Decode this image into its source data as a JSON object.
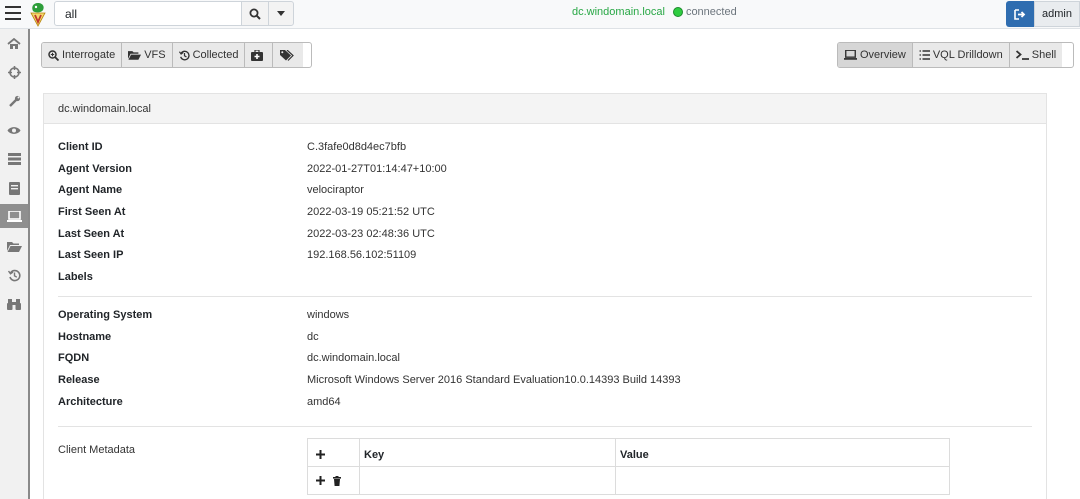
{
  "app": {
    "search": {
      "value": "all"
    },
    "connection": {
      "host": "dc.windomain.local",
      "status": "connected"
    },
    "user": {
      "name": "admin"
    }
  },
  "sidebar": {
    "items": [
      {
        "icon": "home-icon"
      },
      {
        "icon": "crosshairs-icon"
      },
      {
        "icon": "wrench-icon"
      },
      {
        "icon": "eye-icon"
      },
      {
        "icon": "server-icon"
      },
      {
        "icon": "book-icon"
      },
      {
        "icon": "laptop-icon",
        "active": true
      },
      {
        "icon": "folder-open-icon"
      },
      {
        "icon": "history-icon"
      },
      {
        "icon": "binoculars-icon"
      }
    ]
  },
  "toolbar": {
    "interrogate": "Interrogate",
    "vfs": "VFS",
    "collected": "Collected",
    "overview": "Overview",
    "vql_drilldown": "VQL Drilldown",
    "shell": "Shell"
  },
  "client": {
    "header": "dc.windomain.local",
    "fields": [
      {
        "label": "Client ID",
        "value": "C.3fafe0d8d4ec7bfb"
      },
      {
        "label": "Agent Version",
        "value": "2022-01-27T01:14:47+10:00"
      },
      {
        "label": "Agent Name",
        "value": "velociraptor"
      },
      {
        "label": "First Seen At",
        "value": "2022-03-19 05:21:52 UTC"
      },
      {
        "label": "Last Seen At",
        "value": "2022-03-23 02:48:36 UTC"
      },
      {
        "label": "Last Seen IP",
        "value": "192.168.56.102:51109"
      },
      {
        "label": "Labels",
        "value": ""
      }
    ],
    "os_fields": [
      {
        "label": "Operating System",
        "value": "windows"
      },
      {
        "label": "Hostname",
        "value": "dc"
      },
      {
        "label": "FQDN",
        "value": "dc.windomain.local"
      },
      {
        "label": "Release",
        "value": "Microsoft Windows Server 2016 Standard Evaluation10.0.14393 Build 14393"
      },
      {
        "label": "Architecture",
        "value": "amd64"
      }
    ],
    "metadata": {
      "label": "Client Metadata",
      "columns": [
        "Key",
        "Value"
      ]
    }
  },
  "colors": {
    "accent": "#2f6db0",
    "connected": "#28a745",
    "sidebar_active": "#8f8f8f"
  }
}
